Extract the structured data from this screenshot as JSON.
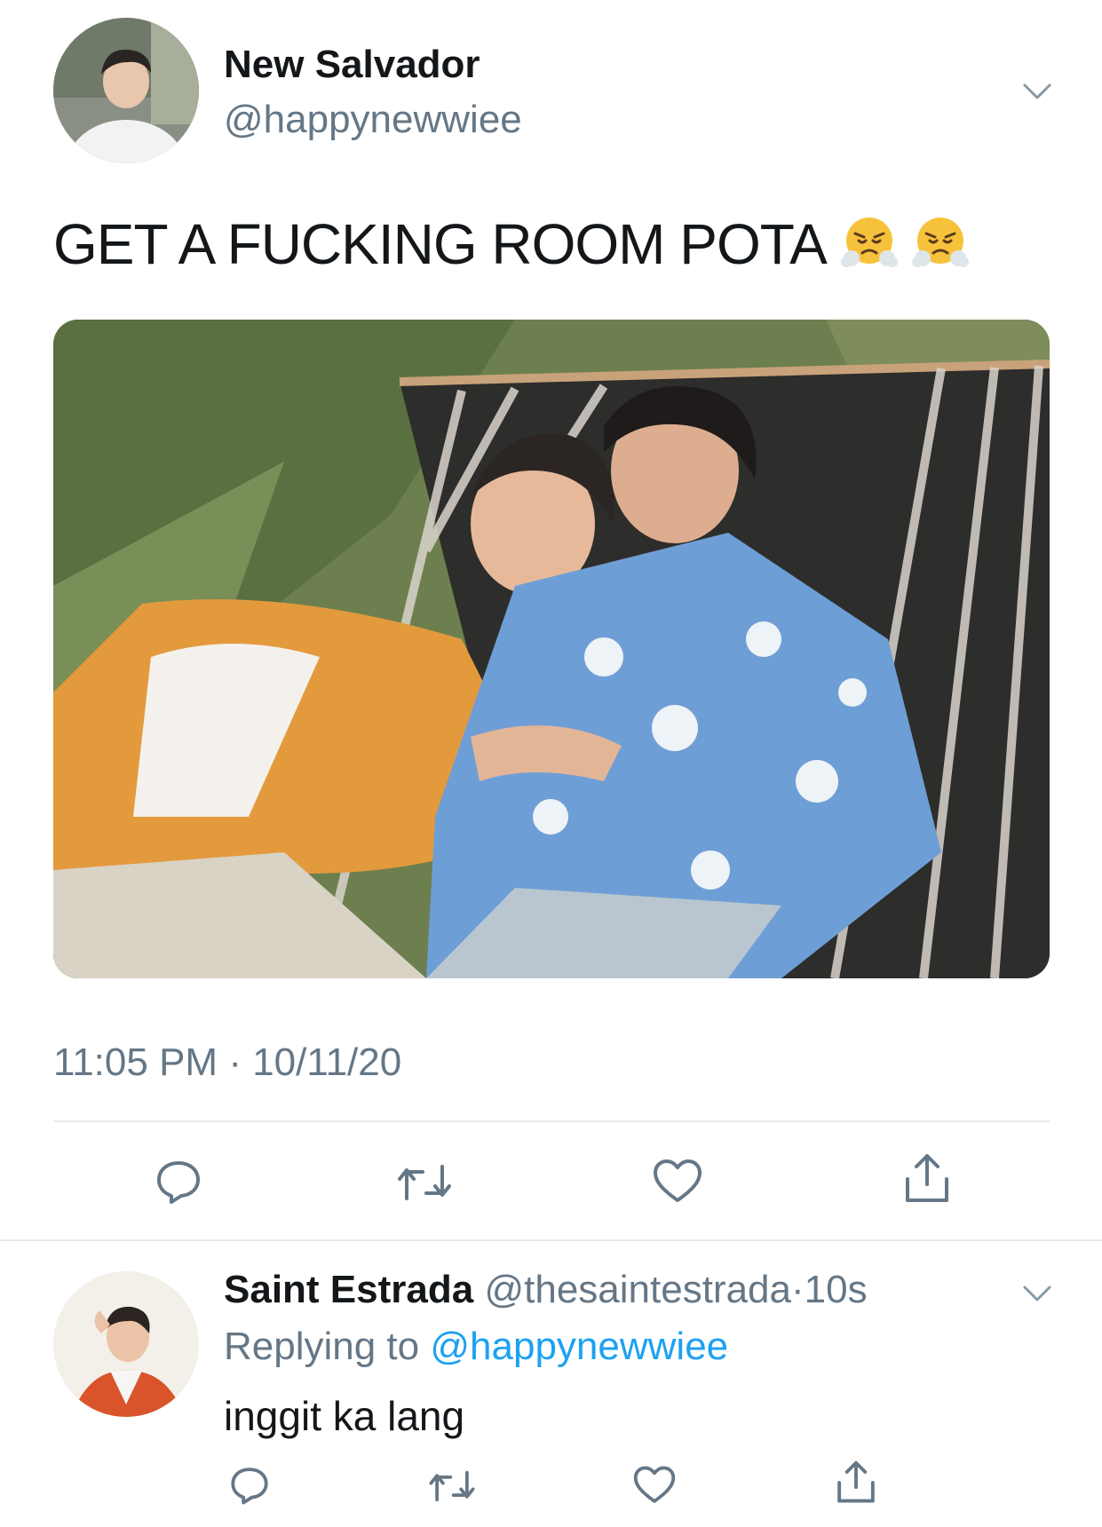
{
  "tweet": {
    "author_name": "New Salvador",
    "author_handle": "@happynewwiee",
    "text": "GET A FUCKING ROOM POTA",
    "emojis": [
      "face-with-steam-from-nose",
      "face-with-steam-from-nose"
    ],
    "time": "11:05 PM",
    "separator": "·",
    "date": "10/11/20",
    "actions": [
      "reply-icon",
      "retweet-icon",
      "like-icon",
      "share-icon"
    ]
  },
  "reply": {
    "author_name": "Saint Estrada",
    "author_handle": "@thesaintestrada",
    "separator": "·",
    "age": "10s",
    "replying_label": "Replying to",
    "replying_handle": "@happynewwiee",
    "text": "inggit ka lang",
    "actions": [
      "reply-icon",
      "retweet-icon",
      "like-icon",
      "share-icon"
    ]
  },
  "colors": {
    "secondary_text": "#657786",
    "link": "#1da1f2",
    "divider": "#e6ecf0"
  }
}
